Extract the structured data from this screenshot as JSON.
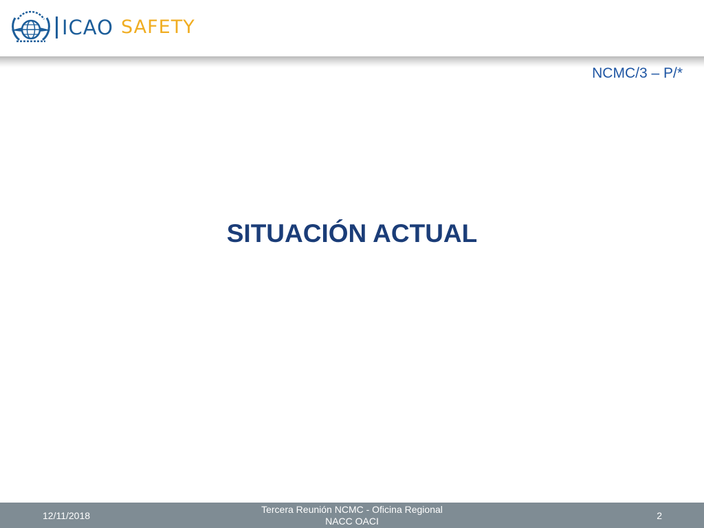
{
  "header": {
    "logo_icao": "ICAO",
    "logo_safety": "SAFETY",
    "emblem_icon": "un-emblem-icon"
  },
  "slide": {
    "ref_code": "NCMC/3 – P/*",
    "title": "SITUACIÓN ACTUAL"
  },
  "footer": {
    "date": "12/11/2018",
    "center_line1": "Tercera Reunión NCMC - Oficina Regional",
    "center_line2": "NACC OACI",
    "page_number": "2"
  },
  "colors": {
    "icao_blue": "#1d5e9a",
    "safety_orange": "#f0ad22",
    "title_navy": "#1b3d78",
    "ref_blue": "#1f56a3",
    "footer_gray": "#7f8c94"
  }
}
